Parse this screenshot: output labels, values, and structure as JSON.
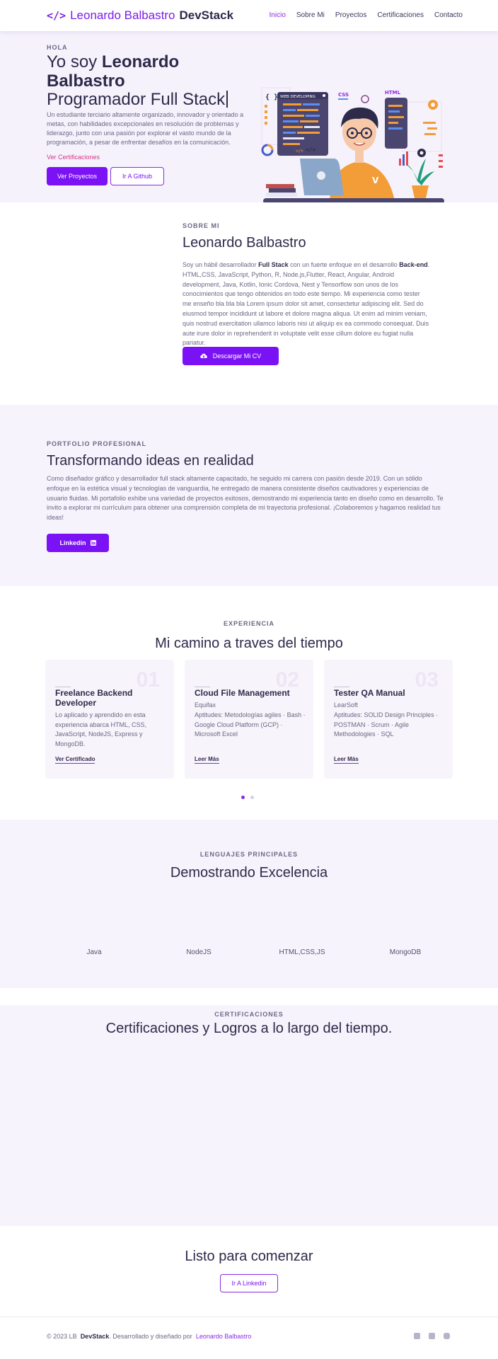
{
  "navbar": {
    "brand_name": "Leonardo Balbastro",
    "brand_suffix": "DevStack",
    "links": [
      "Inicio",
      "Sobre Mi",
      "Proyectos",
      "Certificaciones",
      "Contacto"
    ]
  },
  "hero": {
    "eyebrow": "HOLA",
    "title_prefix": "Yo soy",
    "title_name": "Leonardo Balbastro",
    "role": "Programador Full Stack",
    "description": "Un estudiante terciario altamente organizado, innovador y orientado a metas, con habilidades excepcionales en resolución de problemas y liderazgo, junto con una pasión por explorar el vasto mundo de la programación, a pesar de enfrentar desafíos en la comunicación.",
    "cert_link": "Ver Certificaciones",
    "primary_button": "Ver Proyectos",
    "secondary_button": "Ir A Github",
    "illustration": {
      "panel_label": "WEB DEVELOPING",
      "css_label": "CSS",
      "html_label": "HTML",
      "braces": "{ }",
      "code_tag": "</>"
    }
  },
  "about": {
    "eyebrow": "SOBRE MI",
    "title": "Leonardo Balbastro",
    "text_1": "Soy un hábil desarrollador ",
    "text_bold_1": "Full Stack",
    "text_2": " con un fuerte enfoque en el desarrollo ",
    "text_bold_2": "Back-end",
    "text_3": ". HTML,CSS, JavaScript, Python, R, Node.js,Flutter, React, Angular, Android development, Java, Kotlin, Ionic Cordova, Nest y Tensorflow son unos de los conocimientos que tengo obtenidos en todo este tiempo. Mi experiencia como tester me enseño bla bla bla Lorem ipsum dolor sit amet, consectetur adipiscing elit. Sed do eiusmod tempor incididunt ut labore et dolore magna aliqua. Ut enim ad minim veniam, quis nostrud exercitation ullamco laboris nisi ut aliquip ex ea commodo consequat. Duis aute irure dolor in reprehenderit in voluptate velit esse cillum dolore eu fugiat nulla pariatur.",
    "button": "Descargar Mi CV"
  },
  "portfolio": {
    "eyebrow": "PORTFOLIO PROFESIONAL",
    "title": "Transformando ideas en realidad",
    "text": "Como diseñador gráfico y desarrollador full stack altamente capacitado, he seguido mi carrera con pasión desde 2019. Con un sólido enfoque en la estética visual y tecnologías de vanguardia, he entregado de manera consistente diseños cautivadores y experiencias de usuario fluidas. Mi portafolio exhibe una variedad de proyectos exitosos, demostrando mi experiencia tanto en diseño como en desarrollo. Te invito a explorar mi currículum para obtener una comprensión completa de mi trayectoria profesional. ¡Colaboremos y hagamos realidad tus ideas!",
    "button": "Linkedin"
  },
  "experience": {
    "eyebrow": "EXPERIENCIA",
    "title": "Mi camino a traves del tiempo",
    "cards": [
      {
        "num": "01",
        "title": "Freelance Backend Developer",
        "subtitle": "",
        "body": "Lo aplicado y aprendido en esta experiencia abarca HTML, CSS, JavaScript, NodeJS, Express y MongoDB.",
        "link": "Ver Certificado"
      },
      {
        "num": "02",
        "title": "Cloud File Management",
        "subtitle": "Equifax",
        "body": "Aptitudes: Metodologías agiles · Bash · Google Cloud Platform (GCP) · Microsoft Excel",
        "link": "Leer Más"
      },
      {
        "num": "03",
        "title": "Tester QA Manual",
        "subtitle": "LearSoft",
        "body": "Aptitudes: SOLID Design Principles · POSTMAN · Scrum · Agile Methodologies · SQL",
        "link": "Leer Más"
      }
    ]
  },
  "languages": {
    "eyebrow": "LENGUAJES PRINCIPALES",
    "title": "Demostrando Excelencia",
    "items": [
      "Java",
      "NodeJS",
      "HTML,CSS,JS",
      "MongoDB"
    ]
  },
  "certifications": {
    "eyebrow": "CERTIFICACIONES",
    "title": "Certificaciones y Logros a lo largo del tiempo."
  },
  "cta": {
    "title": "Listo para comenzar",
    "button": "Ir A Linkedin"
  },
  "footer": {
    "copyright": "© 2023 LB",
    "brand": "DevStack",
    "text": ". Desarrollado y diseñado por",
    "author": "Leonardo Balbastro"
  },
  "colors": {
    "accent": "#7b12f5",
    "accent_light": "#8a2be2",
    "heading": "#2d2a4a",
    "muted": "#6b6785",
    "section_bg": "#f7f3fc",
    "link_pink": "#d63384"
  }
}
